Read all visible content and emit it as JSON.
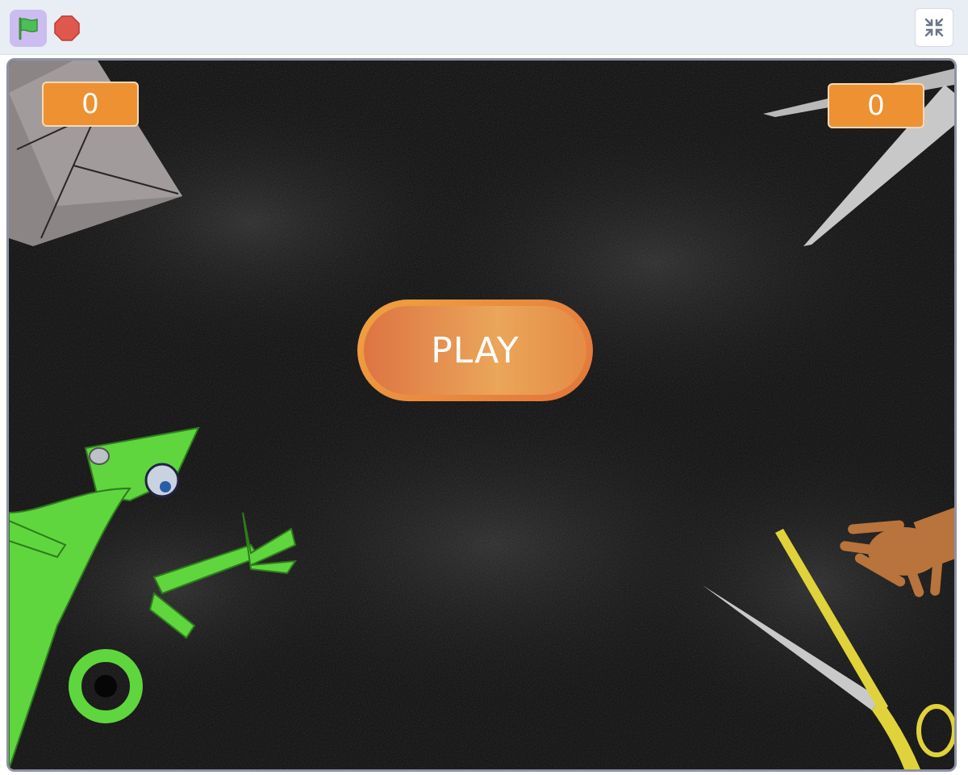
{
  "toolbar": {
    "green_flag_icon": "green-flag-icon",
    "stop_icon": "stop-sign-icon",
    "fullscreen_icon": "exit-fullscreen-icon",
    "flag_color": "#4cbf56",
    "stop_color": "#e0574e"
  },
  "stage": {
    "background": "#050505",
    "score_left": "0",
    "score_right": "0",
    "play_label": "PLAY",
    "accent": "#ee9133"
  }
}
